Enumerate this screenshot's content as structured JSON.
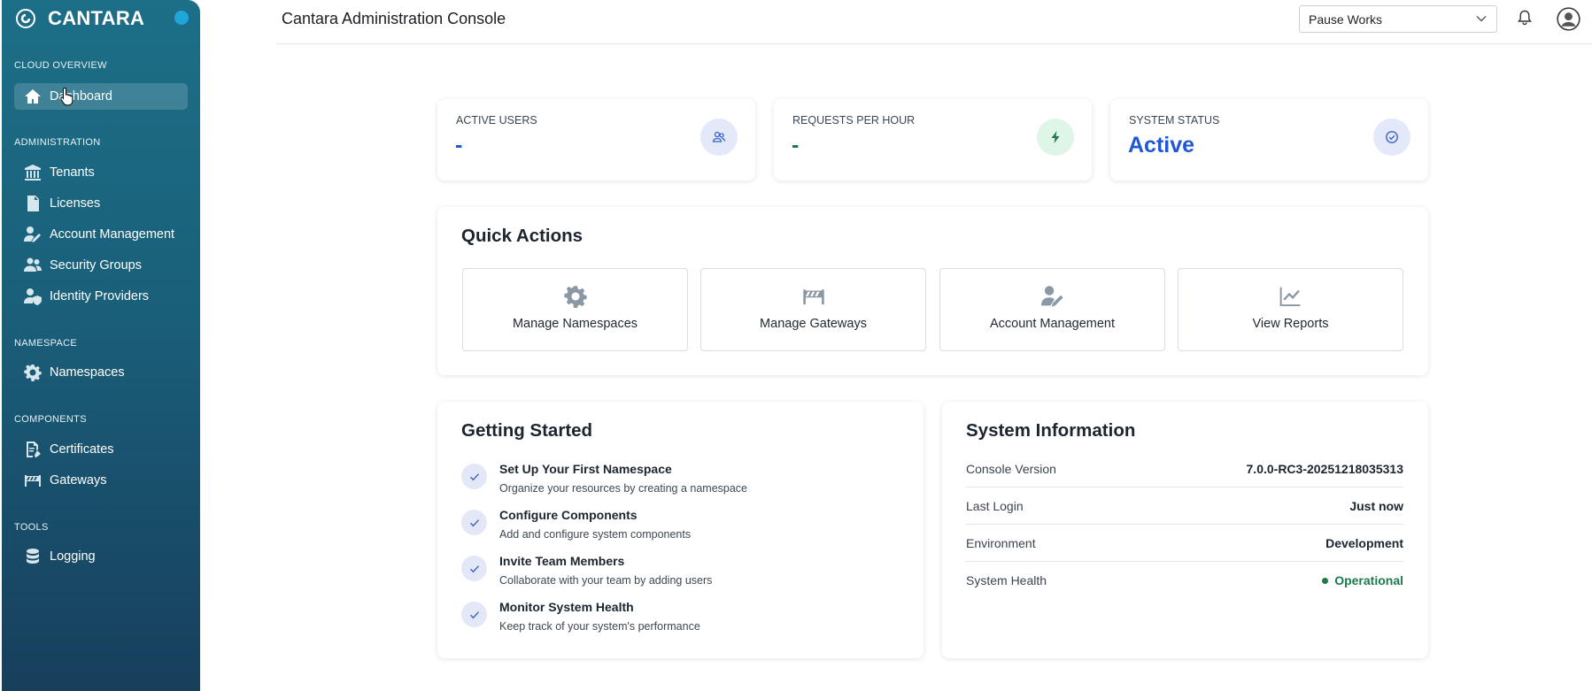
{
  "app": {
    "brand": "CANTARA",
    "title": "Cantara Administration Console"
  },
  "sidebar": {
    "sections": [
      {
        "title": "CLOUD OVERVIEW",
        "items": [
          {
            "label": "Dashboard",
            "icon": "home-icon",
            "active": true
          }
        ]
      },
      {
        "title": "ADMINISTRATION",
        "items": [
          {
            "label": "Tenants",
            "icon": "building-icon"
          },
          {
            "label": "Licenses",
            "icon": "license-icon"
          },
          {
            "label": "Account Management",
            "icon": "user-edit-icon"
          },
          {
            "label": "Security Groups",
            "icon": "users-icon"
          },
          {
            "label": "Identity Providers",
            "icon": "user-shield-icon"
          }
        ]
      },
      {
        "title": "NAMESPACE",
        "items": [
          {
            "label": "Namespaces",
            "icon": "gear-icon"
          }
        ]
      },
      {
        "title": "COMPONENTS",
        "items": [
          {
            "label": "Certificates",
            "icon": "certificate-icon"
          },
          {
            "label": "Gateways",
            "icon": "barrier-icon"
          }
        ]
      },
      {
        "title": "TOOLS",
        "items": [
          {
            "label": "Logging",
            "icon": "database-icon"
          }
        ]
      }
    ]
  },
  "header": {
    "workspace_select": "Pause Works"
  },
  "stats": [
    {
      "label": "ACTIVE USERS",
      "value": "-",
      "value_color": "#1f57d6",
      "icon": "users-icon",
      "icon_bg": "#e3e9f9",
      "icon_color": "#3a60c8"
    },
    {
      "label": "REQUESTS PER HOUR",
      "value": "-",
      "value_color": "#1e7a4d",
      "icon": "bolt-icon",
      "icon_bg": "#dff5e7",
      "icon_color": "#1e7a4d"
    },
    {
      "label": "SYSTEM STATUS",
      "value": "Active",
      "value_color": "#1f57d6",
      "icon": "check-circle-icon",
      "icon_bg": "#e3e9f9",
      "icon_color": "#3a60c8"
    }
  ],
  "quick_actions": {
    "title": "Quick Actions",
    "buttons": [
      {
        "label": "Manage Namespaces",
        "icon": "gear-icon"
      },
      {
        "label": "Manage Gateways",
        "icon": "barrier-icon"
      },
      {
        "label": "Account Management",
        "icon": "user-edit-icon"
      },
      {
        "label": "View Reports",
        "icon": "chart-line-icon"
      }
    ]
  },
  "getting_started": {
    "title": "Getting Started",
    "steps": [
      {
        "title": "Set Up Your First Namespace",
        "desc": "Organize your resources by creating a namespace"
      },
      {
        "title": "Configure Components",
        "desc": "Add and configure system components"
      },
      {
        "title": "Invite Team Members",
        "desc": "Collaborate with your team by adding users"
      },
      {
        "title": "Monitor System Health",
        "desc": "Keep track of your system's performance"
      }
    ]
  },
  "system_info": {
    "title": "System Information",
    "rows": [
      {
        "key": "Console Version",
        "value": "7.0.0-RC3-20251218035313"
      },
      {
        "key": "Last Login",
        "value": "Just now"
      },
      {
        "key": "Environment",
        "value": "Development"
      },
      {
        "key": "System Health",
        "value": "Operational",
        "status": "ok"
      }
    ]
  },
  "colors": {
    "accent": "#1f57d6",
    "success": "#1a7a4a",
    "sidebar_top": "#1c6f87",
    "sidebar_bottom": "#173f5c"
  }
}
